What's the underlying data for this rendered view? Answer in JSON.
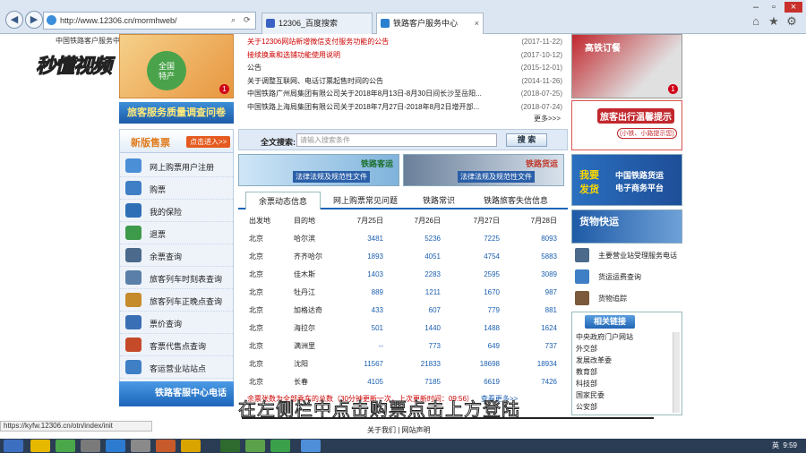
{
  "browser": {
    "address": "http://www.12306.cn/mormhweb/",
    "tabs": [
      {
        "label": "12306_百度搜索"
      },
      {
        "label": "铁路客户服务中心"
      }
    ]
  },
  "logo": {
    "top_text": "中国铁路客户服务中心",
    "brand": "秒懂视频"
  },
  "banner_left": {
    "circle_text": "全国\n特产",
    "badge": "1"
  },
  "survey_label": "旅客服务质量调查问卷",
  "news": [
    {
      "title": "关于12306网站新增微信支付服务功能的公告",
      "date": "(2017-11-22)",
      "red": true
    },
    {
      "title": "接续换乘和选铺功能使用说明",
      "date": "(2017-10-12)",
      "red": true
    },
    {
      "title": "公告",
      "date": "(2015-12-01)",
      "red": false
    },
    {
      "title": "关于调整互联网、电话订票起售时间的公告",
      "date": "(2014-11-26)",
      "red": false
    },
    {
      "title": "中国铁路广州局集团有限公司关于2018年8月13日-8月30日间长沙至岳阳...",
      "date": "(2018-07-25)",
      "red": false
    },
    {
      "title": "中国铁路上海局集团有限公司关于2018年7月27日-2018年8月2日增开部...",
      "date": "(2018-07-24)",
      "red": false
    }
  ],
  "more_label": "更多>>>",
  "banner_right": {
    "text": "高铁订餐",
    "badge": "1"
  },
  "tips": {
    "title": "旅客出行温馨提示",
    "sub": "(小铁、小路提示您)"
  },
  "sidebar": {
    "title": "新版售票",
    "enter_label": "点击进入>>",
    "items": [
      {
        "label": "网上购票用户注册"
      },
      {
        "label": "购票"
      },
      {
        "label": "我的保险"
      },
      {
        "label": "退票"
      },
      {
        "label": "余票查询"
      },
      {
        "label": "旅客列车时刻表查询"
      },
      {
        "label": "旅客列车正晚点查询"
      },
      {
        "label": "票价查询"
      },
      {
        "label": "客票代售点查询"
      },
      {
        "label": "客运营业站站点"
      }
    ],
    "hotline": "铁路客服中心电话"
  },
  "search": {
    "label": "全文搜索:",
    "placeholder": "请输入搜索条件",
    "button": "搜 索"
  },
  "banners": [
    {
      "title": "铁路客运",
      "sub": "法律法规及规范性文件"
    },
    {
      "title": "铁路货运",
      "sub": "法律法规及规范性文件"
    }
  ],
  "content_tabs": [
    {
      "label": "余票动态信息"
    },
    {
      "label": "网上购票常见问题"
    },
    {
      "label": "铁路常识"
    },
    {
      "label": "铁路旅客失信信息"
    }
  ],
  "table": {
    "headers": [
      "出发地",
      "目的地",
      "7月25日",
      "7月26日",
      "7月27日",
      "7月28日"
    ],
    "rows": [
      [
        "北京",
        "哈尔滨",
        "3481",
        "5236",
        "7225",
        "8093"
      ],
      [
        "北京",
        "齐齐哈尔",
        "1893",
        "4051",
        "4754",
        "5883"
      ],
      [
        "北京",
        "佳木斯",
        "1403",
        "2283",
        "2595",
        "3089"
      ],
      [
        "北京",
        "牡丹江",
        "889",
        "1211",
        "1670",
        "987"
      ],
      [
        "北京",
        "加格达奇",
        "433",
        "607",
        "779",
        "881"
      ],
      [
        "北京",
        "海拉尔",
        "501",
        "1440",
        "1488",
        "1624"
      ],
      [
        "北京",
        "满洲里",
        "--",
        "773",
        "649",
        "737"
      ],
      [
        "北京",
        "沈阳",
        "11567",
        "21833",
        "18698",
        "18934"
      ],
      [
        "北京",
        "长春",
        "4105",
        "7185",
        "6619",
        "7426"
      ]
    ],
    "note": "余票张数为全部乘车的总数（30分钟更新一次，上次更新时间：09:56）",
    "more": "查看更多>>"
  },
  "right": {
    "freight": {
      "l1": "我要",
      "l2": "发货",
      "title": "中国铁路货运",
      "sub": "电子商务平台"
    },
    "express": "货物快运",
    "items": [
      {
        "label": "主要营业站受理服务电话"
      },
      {
        "label": "货运运费查询"
      },
      {
        "label": "货物追踪"
      }
    ],
    "links_title": "相关链接",
    "links": [
      "中央政府门户网站",
      "外交部",
      "发展改革委",
      "教育部",
      "科技部",
      "国家民委",
      "公安部"
    ]
  },
  "subtitle": "在左侧栏中点击购票点击上方登陆",
  "footer": "关于我们 | 网站声明",
  "status_url": "https://kyfw.12306.cn/otn/index/init",
  "taskbar": {
    "lang": "英",
    "time": "9:59"
  },
  "colors": {
    "accent_blue": "#1b64b8",
    "news_red": "#cc0000",
    "sidebar_orange": "#e07a1a"
  }
}
